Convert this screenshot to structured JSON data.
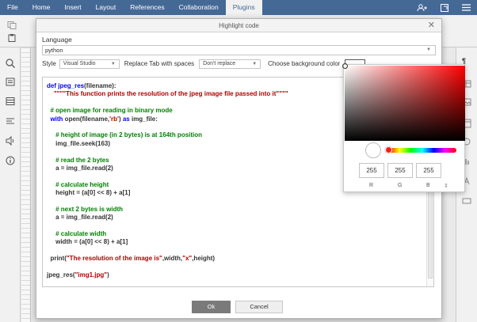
{
  "menu": {
    "tabs": [
      "File",
      "Home",
      "Insert",
      "Layout",
      "References",
      "Collaboration",
      "Plugins"
    ],
    "active": "Plugins"
  },
  "dialog": {
    "title": "Highlight code",
    "close": "✕",
    "language_label": "Language",
    "language_value": "python",
    "style_label": "Style",
    "style_value": "Visual Studio",
    "replace_label": "Replace Tab with spaces",
    "replace_value": "Don't replace",
    "bg_label": "Choose background color",
    "ok_label": "Ok",
    "cancel_label": "Cancel"
  },
  "code": {
    "l01_kw": "def",
    "l01_fn": " jpeg_res",
    "l01_rest": "(filename):",
    "l02": "    \"\"\"\"This function prints the resolution of the jpeg image file passed into it\"\"\"\"",
    "l04": "  # open image for reading in binary mode",
    "l05_kw": "  with",
    "l05_a": " open(filename,",
    "l05_str": "'rb'",
    "l05_b": ") ",
    "l05_kw2": "as",
    "l05_c": " img_file:",
    "l07": "     # height of image (in 2 bytes) is at 164th position",
    "l08": "     img_file.seek(163)",
    "l10": "     # read the 2 bytes",
    "l11": "     a = img_file.read(2)",
    "l13": "     # calculate height",
    "l14": "     height = (a[0] << 8) + a[1]",
    "l16": "     # next 2 bytes is width",
    "l17": "     a = img_file.read(2)",
    "l19": "     # calculate width",
    "l20": "     width = (a[0] << 8) + a[1]",
    "l22_a": "  print(",
    "l22_str": "\"The resolution of the image is\"",
    "l22_b": ",width,",
    "l22_str2": "\"x\"",
    "l22_c": ",height)",
    "l24_a": "jpeg_res(",
    "l24_str": "\"img1.jpg\"",
    "l24_b": ")"
  },
  "picker": {
    "r": "255",
    "g": "255",
    "b": "255",
    "r_label": "R",
    "g_label": "G",
    "b_label": "B"
  },
  "colors": {
    "menubar": "#446995",
    "keyword": "#0000ff",
    "string": "#b00000",
    "comment": "#008000"
  }
}
